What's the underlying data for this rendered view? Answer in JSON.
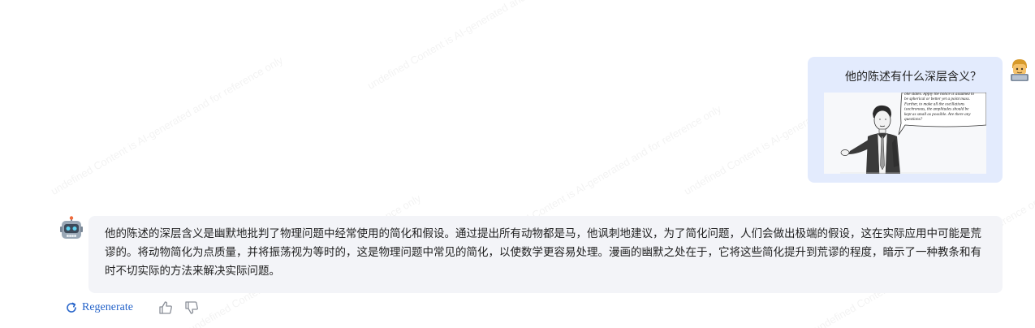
{
  "watermark": {
    "text": "undefined Content is AI-generated and for reference only"
  },
  "user_message": {
    "text": "他的陈述有什么深层含义？",
    "avatar_icon": "user-avatar-icon",
    "image": {
      "icon": "comic-lecturer-image",
      "speech_lines": [
        "one states. Apply the notice is assumed to",
        "be spherical or better yet a point mass.",
        "Further, to make all the oscillations",
        "isochronous, the amplitudes should be",
        "kept as small as possible.  Are there any",
        "questions?"
      ]
    }
  },
  "assistant_message": {
    "avatar_icon": "robot-avatar-icon",
    "text": "他的陈述的深层含义是幽默地批判了物理问题中经常使用的简化和假设。通过提出所有动物都是马，他讽刺地建议，为了简化问题，人们会做出极端的假设，这在实际应用中可能是荒谬的。将动物简化为点质量，并将振荡视为等时的，这是物理问题中常见的简化，以使数学更容易处理。漫画的幽默之处在于，它将这些简化提升到荒谬的程度，暗示了一种教条和有时不切实际的方法来解决实际问题。"
  },
  "actions": {
    "regenerate_label": "Regenerate",
    "regenerate_icon": "refresh-icon",
    "like_icon": "thumbs-up-icon",
    "dislike_icon": "thumbs-down-icon"
  },
  "colors": {
    "user_bubble": "#e3ebfd",
    "assistant_bubble": "#f3f4f8",
    "accent": "#2563c9"
  }
}
